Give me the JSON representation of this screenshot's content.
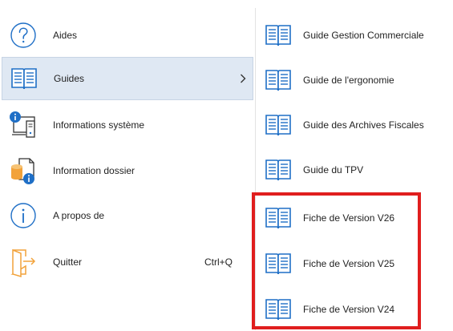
{
  "left_menu": {
    "items": [
      {
        "label": "Aides",
        "icon": "help-circle-icon"
      },
      {
        "label": "Guides",
        "icon": "book-icon",
        "active": true,
        "submenu_indicator": "›"
      },
      {
        "label": "Informations système",
        "icon": "system-info-icon"
      },
      {
        "label": "Information dossier",
        "icon": "database-info-icon"
      },
      {
        "label": "A propos de",
        "icon": "info-circle-icon"
      },
      {
        "label": "Quitter",
        "icon": "exit-icon",
        "shortcut": "Ctrl+Q"
      }
    ]
  },
  "guides_submenu": {
    "items": [
      {
        "label": "Guide Gestion Commerciale",
        "icon": "book-icon"
      },
      {
        "label": "Guide de l'ergonomie",
        "icon": "book-icon"
      },
      {
        "label": "Guide des Archives Fiscales",
        "icon": "book-icon"
      },
      {
        "label": "Guide du TPV",
        "icon": "book-icon"
      },
      {
        "label": "Fiche de Version V26",
        "icon": "book-icon"
      },
      {
        "label": "Fiche de Version V25",
        "icon": "book-icon"
      },
      {
        "label": "Fiche de Version V24",
        "icon": "book-icon"
      }
    ]
  },
  "colors": {
    "icon_blue": "#1f6fc6",
    "active_bg": "#dfe8f3",
    "highlight": "#e01e1e",
    "folder_orange": "#f2a23a"
  }
}
